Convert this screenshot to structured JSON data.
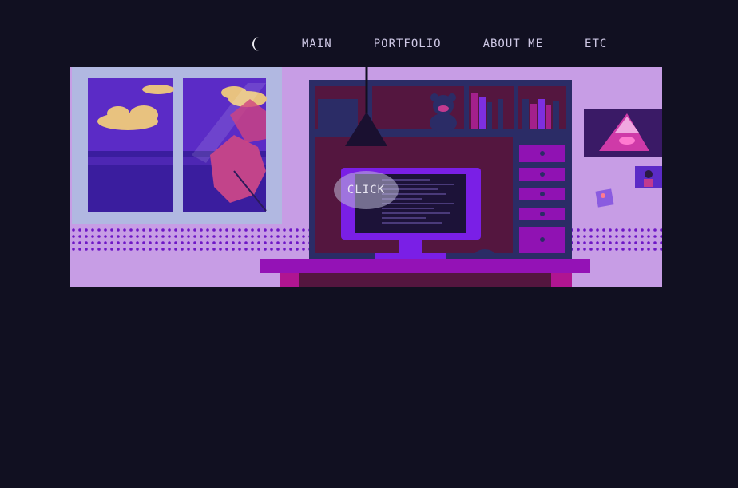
{
  "nav": {
    "theme_toggle_icon": "crescent-moon-icon",
    "items": [
      {
        "label": "MAIN"
      },
      {
        "label": "PORTFOLIO"
      },
      {
        "label": "ABOUT ME"
      },
      {
        "label": "ETC"
      }
    ]
  },
  "hero": {
    "click_label": "CLICK"
  },
  "colors": {
    "page_background": "#111021",
    "wall": "#c79de5",
    "window_frame": "#b1b8e1",
    "shelf": "#2b2c66",
    "desk": "#9412b6",
    "monitor": "#7a1fe6"
  }
}
